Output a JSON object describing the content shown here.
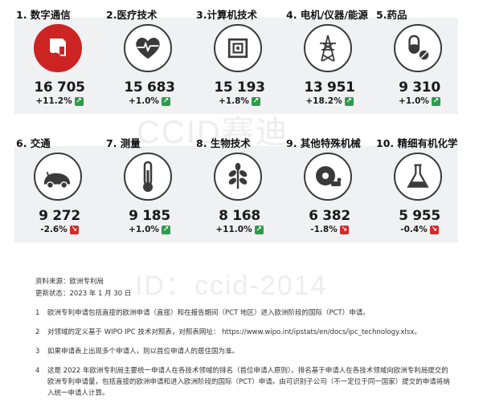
{
  "categories": [
    {
      "rank_label": "1. 数字通信",
      "value": "16 705",
      "change": "+11.2%",
      "trend": "up",
      "icon": "digital-communication-icon",
      "active": true
    },
    {
      "rank_label": "2.医疗技术",
      "value": "15 683",
      "change": "+1.0%",
      "trend": "up",
      "icon": "heart-pulse-icon",
      "active": false
    },
    {
      "rank_label": "3.计算机技术",
      "value": "15 193",
      "change": "+1.8%",
      "trend": "up",
      "icon": "chip-icon",
      "active": false
    },
    {
      "rank_label": "4. 电机/仪器/能源",
      "value": "13 951",
      "change": "+18.2%",
      "trend": "up",
      "icon": "power-tower-icon",
      "active": false
    },
    {
      "rank_label": "5.药品",
      "value": "9 310",
      "change": "+1.0%",
      "trend": "up",
      "icon": "pills-icon",
      "active": false
    },
    {
      "rank_label": "6. 交通",
      "value": "9 272",
      "change": "-2.6%",
      "trend": "down",
      "icon": "car-icon",
      "active": false
    },
    {
      "rank_label": "7. 测量",
      "value": "9 185",
      "change": "+1.0%",
      "trend": "up",
      "icon": "thermometer-icon",
      "active": false
    },
    {
      "rank_label": "8. 生物技术",
      "value": "8 168",
      "change": "+11.0%",
      "trend": "up",
      "icon": "leaf-icon",
      "active": false
    },
    {
      "rank_label": "9. 其他特殊机械",
      "value": "6 382",
      "change": "-1.8%",
      "trend": "down",
      "icon": "machine-icon",
      "active": false
    },
    {
      "rank_label": "10. 精细有机化学",
      "value": "5 955",
      "change": "-0.4%",
      "trend": "down",
      "icon": "flask-icon",
      "active": false
    }
  ],
  "watermarks": {
    "top": "CCID赛迪",
    "bottom": "ID：ccid-2014"
  },
  "source": {
    "line1": "资料来源：欧洲专利局",
    "line2": "更新状态：2023 年 1 月 30 日"
  },
  "notes": [
    {
      "num": "1",
      "text": "欧洲专利申请包括直接的欧洲申请（直接）和在报告期间（PCT 地区）进入欧洲阶段的国际（PCT）申请。"
    },
    {
      "num": "2",
      "text": "对领域的定义基于 WIPO IPC 技术对照表，对照表网址： https://www.wipo.int/ipstats/en/docs/ipc_technology.xlsx。"
    },
    {
      "num": "3",
      "text": "如果申请表上出现多个申请人，则以首位申请人的居住国为准。"
    },
    {
      "num": "4",
      "text": "这是 2022 年欧洲专利局主要统一申请人在各技术领域的排名（首位申请人原则）。排名基于申请人在各技术领域向欧洲专利局提交的欧洲专利申请量，包括直接的欧洲申请和进入欧洲阶段的国际（PCT）申请。由可识别子公司（不一定位于同一国家）提交的申请将纳入统一申请人计算。"
    }
  ],
  "colors": {
    "accent": "#cc2422",
    "up": "#2e9b4a",
    "down": "#d42a2a",
    "panel": "#f0f1f3"
  }
}
